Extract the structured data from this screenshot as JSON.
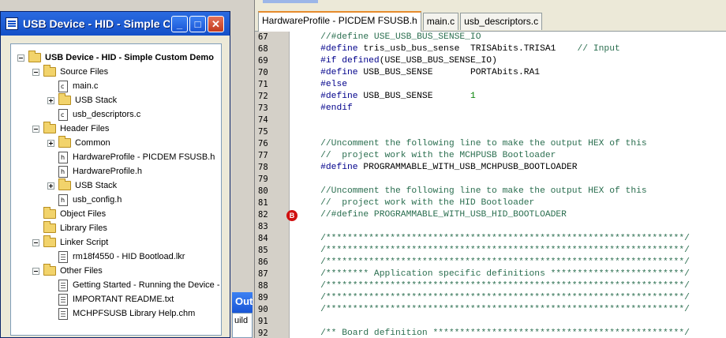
{
  "project_window": {
    "title": "USB Device - HID - Simple C...",
    "minimize_label": "_",
    "maximize_label": "□",
    "close_label": "✕",
    "tree": [
      {
        "label": "USB Device - HID - Simple Custom Demo",
        "level": 0,
        "kind": "folder",
        "expander": "minus"
      },
      {
        "label": "Source Files",
        "level": 1,
        "kind": "folder",
        "expander": "minus"
      },
      {
        "label": "main.c",
        "level": 2,
        "kind": "c-file"
      },
      {
        "label": "USB Stack",
        "level": 2,
        "kind": "folder",
        "expander": "plus"
      },
      {
        "label": "usb_descriptors.c",
        "level": 2,
        "kind": "c-file"
      },
      {
        "label": "Header Files",
        "level": 1,
        "kind": "folder",
        "expander": "minus"
      },
      {
        "label": "Common",
        "level": 2,
        "kind": "folder",
        "expander": "plus"
      },
      {
        "label": "HardwareProfile - PICDEM FSUSB.h",
        "level": 2,
        "kind": "h-file"
      },
      {
        "label": "HardwareProfile.h",
        "level": 2,
        "kind": "h-file"
      },
      {
        "label": "USB Stack",
        "level": 2,
        "kind": "folder",
        "expander": "plus"
      },
      {
        "label": "usb_config.h",
        "level": 2,
        "kind": "h-file"
      },
      {
        "label": "Object Files",
        "level": 1,
        "kind": "folder"
      },
      {
        "label": "Library Files",
        "level": 1,
        "kind": "folder"
      },
      {
        "label": "Linker Script",
        "level": 1,
        "kind": "folder",
        "expander": "minus"
      },
      {
        "label": "rm18f4550 - HID Bootload.lkr",
        "level": 2,
        "kind": "text-file"
      },
      {
        "label": "Other Files",
        "level": 1,
        "kind": "folder",
        "expander": "minus"
      },
      {
        "label": "Getting Started - Running the Device -",
        "level": 2,
        "kind": "text-file"
      },
      {
        "label": "IMPORTANT README.txt",
        "level": 2,
        "kind": "text-file"
      },
      {
        "label": "MCHPFSUSB Library Help.chm",
        "level": 2,
        "kind": "text-file"
      }
    ]
  },
  "output_window": {
    "title": "Out",
    "tab_label": "uild"
  },
  "editor": {
    "tabs": [
      {
        "label": "HardwareProfile - PICDEM FSUSB.h",
        "active": true
      },
      {
        "label": "main.c",
        "active": false
      },
      {
        "label": "usb_descriptors.c",
        "active": false
      }
    ],
    "breakpoint_line": 82,
    "breakpoint_label": "B",
    "lines": [
      {
        "n": "67",
        "parts": [
          {
            "t": "    //#define USE_USB_BUS_SENSE_IO",
            "c": "cm"
          }
        ]
      },
      {
        "n": "68",
        "parts": [
          {
            "t": "    #define",
            "c": "pp"
          },
          {
            "t": " tris_usb_bus_sense  TRISAbits.TRISA1    ",
            "c": ""
          },
          {
            "t": "// Input",
            "c": "cm"
          }
        ]
      },
      {
        "n": "69",
        "parts": [
          {
            "t": "    #if defined",
            "c": "pp"
          },
          {
            "t": "(USE_USB_BUS_SENSE_IO)",
            "c": ""
          }
        ]
      },
      {
        "n": "70",
        "parts": [
          {
            "t": "    #define",
            "c": "pp"
          },
          {
            "t": " USB_BUS_SENSE       PORTAbits.RA1",
            "c": ""
          }
        ]
      },
      {
        "n": "71",
        "parts": [
          {
            "t": "    #else",
            "c": "pp"
          }
        ]
      },
      {
        "n": "72",
        "parts": [
          {
            "t": "    #define",
            "c": "pp"
          },
          {
            "t": " USB_BUS_SENSE       ",
            "c": ""
          },
          {
            "t": "1",
            "c": "num"
          }
        ]
      },
      {
        "n": "73",
        "parts": [
          {
            "t": "    #endif",
            "c": "pp"
          }
        ]
      },
      {
        "n": "74",
        "parts": []
      },
      {
        "n": "75",
        "parts": []
      },
      {
        "n": "76",
        "parts": [
          {
            "t": "    //Uncomment the following line to make the output HEX of this",
            "c": "cm"
          }
        ]
      },
      {
        "n": "77",
        "parts": [
          {
            "t": "    //  project work with the MCHPUSB Bootloader",
            "c": "cm"
          }
        ]
      },
      {
        "n": "78",
        "parts": [
          {
            "t": "    #define",
            "c": "pp"
          },
          {
            "t": " PROGRAMMABLE_WITH_USB_MCHPUSB_BOOTLOADER",
            "c": ""
          }
        ]
      },
      {
        "n": "79",
        "parts": []
      },
      {
        "n": "80",
        "parts": [
          {
            "t": "    //Uncomment the following line to make the output HEX of this",
            "c": "cm"
          }
        ]
      },
      {
        "n": "81",
        "parts": [
          {
            "t": "    //  project work with the HID Bootloader",
            "c": "cm"
          }
        ]
      },
      {
        "n": "82",
        "parts": [
          {
            "t": "    //#define PROGRAMMABLE_WITH_USB_HID_BOOTLOADER",
            "c": "cm"
          }
        ]
      },
      {
        "n": "83",
        "parts": []
      },
      {
        "n": "84",
        "parts": [
          {
            "t": "    /*******************************************************************/",
            "c": "cm"
          }
        ]
      },
      {
        "n": "85",
        "parts": [
          {
            "t": "    /*******************************************************************/",
            "c": "cm"
          }
        ]
      },
      {
        "n": "86",
        "parts": [
          {
            "t": "    /*******************************************************************/",
            "c": "cm"
          }
        ]
      },
      {
        "n": "87",
        "parts": [
          {
            "t": "    /******** Application specific definitions *************************/",
            "c": "cm"
          }
        ]
      },
      {
        "n": "88",
        "parts": [
          {
            "t": "    /*******************************************************************/",
            "c": "cm"
          }
        ]
      },
      {
        "n": "89",
        "parts": [
          {
            "t": "    /*******************************************************************/",
            "c": "cm"
          }
        ]
      },
      {
        "n": "90",
        "parts": [
          {
            "t": "    /*******************************************************************/",
            "c": "cm"
          }
        ]
      },
      {
        "n": "91",
        "parts": []
      },
      {
        "n": "92",
        "parts": [
          {
            "t": "    /** Board definition ***********************************************/",
            "c": "cm"
          }
        ]
      }
    ]
  },
  "colors": {
    "preprocessor": "#00008b",
    "comment": "#2a6e4f",
    "number": "#008000",
    "breakpoint": "#d01010"
  }
}
